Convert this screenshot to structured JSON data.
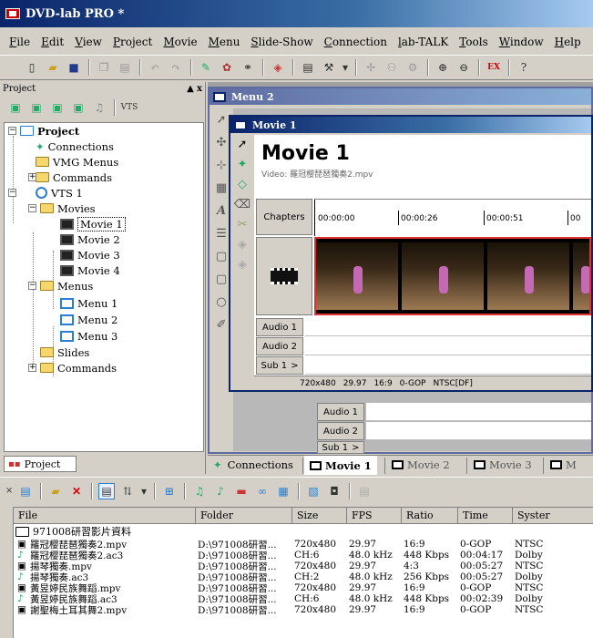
{
  "app": {
    "title": "DVD-lab PRO *"
  },
  "menubar": {
    "items": [
      "File",
      "Edit",
      "View",
      "Project",
      "Movie",
      "Menu",
      "Slide-Show",
      "Connection",
      "lab-TALK",
      "Tools",
      "Window",
      "Help"
    ]
  },
  "project_panel": {
    "header": "Project",
    "close": "x",
    "tree": {
      "root": "Project",
      "connections": "Connections",
      "vmg": "VMG Menus",
      "commands": "Commands",
      "vts": "VTS 1",
      "movies": "Movies",
      "movie_items": [
        "Movie 1",
        "Movie 2",
        "Movie 3",
        "Movie 4"
      ],
      "menus": "Menus",
      "menu_items": [
        "Menu 1",
        "Menu 2",
        "Menu 3"
      ],
      "slides": "Slides",
      "commands2": "Commands"
    },
    "footer_tab": "Project"
  },
  "menu2_window": {
    "title": "Menu 2"
  },
  "movie1_window": {
    "title": "Movie 1",
    "heading": "Movie 1",
    "video_label": "Video: 羅冠樱琵琶獨奏2.mpv",
    "chapters_label": "Chapters",
    "timecodes": [
      "00:00:00",
      "00:00:26",
      "00:00:51",
      "00"
    ],
    "tracks": [
      "Audio 1",
      "Audio 2",
      "Sub 1"
    ],
    "sub_arrow": ">",
    "status": [
      "720x480",
      "29.97",
      "16:9",
      "0-GOP",
      "NTSC[DF]"
    ]
  },
  "behind_tracks": [
    "Audio 1",
    "Audio 2",
    "Sub 1"
  ],
  "doc_tabs": [
    "Connections",
    "Movie 1",
    "Movie 2",
    "Movie 3",
    "M"
  ],
  "assets": {
    "columns": [
      "File",
      "Folder",
      "Size",
      "FPS",
      "Ratio",
      "Time",
      "Syster"
    ],
    "folder_row": "971008研習影片資料",
    "rows": [
      {
        "file": "羅冠樱琵琶獨奏2.mpv",
        "folder": "D:\\971008研習...",
        "size": "720x480",
        "fps": "29.97",
        "ratio": "16:9",
        "time": "0-GOP",
        "sys": "NTSC"
      },
      {
        "file": "羅冠樱琵琶獨奏2.ac3",
        "folder": "D:\\971008研習...",
        "size": "CH:6",
        "fps": "48.0 kHz",
        "ratio": "448 Kbps",
        "time": "00:04:17",
        "sys": "Dolby"
      },
      {
        "file": "揚琴獨奏.mpv",
        "folder": "D:\\971008研習...",
        "size": "720x480",
        "fps": "29.97",
        "ratio": "4:3",
        "time": "00:05:27",
        "sys": "NTSC"
      },
      {
        "file": "揚琴獨奏.ac3",
        "folder": "D:\\971008研習...",
        "size": "CH:2",
        "fps": "48.0 kHz",
        "ratio": "256 Kbps",
        "time": "00:05:27",
        "sys": "Dolby"
      },
      {
        "file": "黃昱婷民族舞蹈.mpv",
        "folder": "D:\\971008研習...",
        "size": "720x480",
        "fps": "29.97",
        "ratio": "16:9",
        "time": "0-GOP",
        "sys": "NTSC"
      },
      {
        "file": "黃昱婷民族舞蹈.ac3",
        "folder": "D:\\971008研習...",
        "size": "CH:6",
        "fps": "48.0 kHz",
        "ratio": "448 Kbps",
        "time": "00:02:39",
        "sys": "Dolby"
      },
      {
        "file": "謝聖梅土耳其舞2.mpv",
        "folder": "D:\\971008研習...",
        "size": "720x480",
        "fps": "29.97",
        "ratio": "16:9",
        "time": "0-GOP",
        "sys": "NTSC"
      }
    ]
  },
  "colors": {
    "accent": "#0a246a",
    "chrome": "#d4d0c8",
    "timeline_border": "#e03030"
  }
}
